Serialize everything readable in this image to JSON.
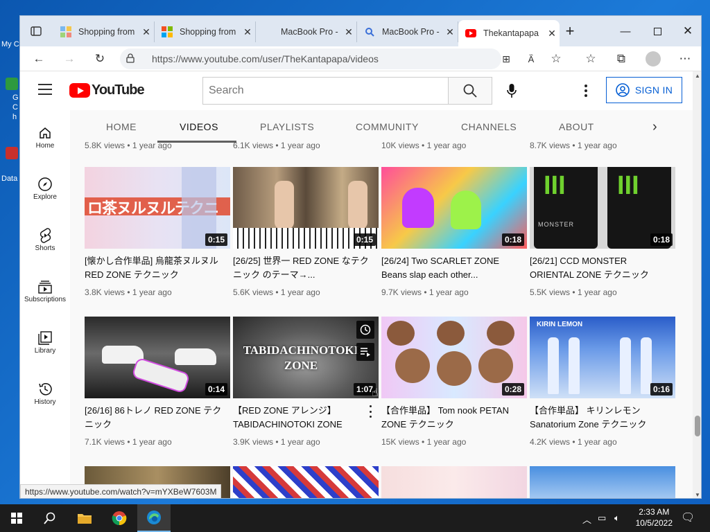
{
  "desktop": {
    "icons": [
      {
        "label": "My C"
      },
      {
        "label": "G Ch"
      },
      {
        "label": "Data"
      }
    ]
  },
  "browser": {
    "tabs": [
      {
        "title": "Shopping from",
        "icon": "shopping-favicon",
        "active": false
      },
      {
        "title": "Shopping from",
        "icon": "microsoft-favicon",
        "active": false
      },
      {
        "title": "MacBook Pro -",
        "icon": "apple-favicon",
        "active": false
      },
      {
        "title": "MacBook Pro -",
        "icon": "search-favicon",
        "active": false
      },
      {
        "title": "Thekantapapa",
        "icon": "youtube-favicon",
        "active": true
      }
    ],
    "url": "https://www.youtube.com/user/TheKantapapa/videos",
    "status_url": "https://www.youtube.com/watch?v=mYXBeW7603M"
  },
  "youtube": {
    "logo_text": "YouTube",
    "search_placeholder": "Search",
    "signin_label": "SIGN IN",
    "sidebar": [
      {
        "label": "Home",
        "icon": "home-icon"
      },
      {
        "label": "Explore",
        "icon": "compass-icon"
      },
      {
        "label": "Shorts",
        "icon": "shorts-icon"
      },
      {
        "label": "Subscriptions",
        "icon": "subscriptions-icon"
      },
      {
        "label": "Library",
        "icon": "library-icon"
      },
      {
        "label": "History",
        "icon": "history-icon"
      }
    ],
    "channel_tabs": [
      "HOME",
      "VIDEOS",
      "PLAYLISTS",
      "COMMUNITY",
      "CHANNELS",
      "ABOUT"
    ],
    "active_tab": "VIDEOS",
    "prev_row_meta": [
      {
        "views": "5.8K views",
        "age": "1 year ago"
      },
      {
        "views": "6.1K views",
        "age": "1 year ago"
      },
      {
        "views": "10K views",
        "age": "1 year ago"
      },
      {
        "views": "8.7K views",
        "age": "1 year ago"
      }
    ],
    "rows": [
      [
        {
          "title": "[懐かし合作単品] 烏龍茶ヌルヌル RED ZONE テクニック",
          "duration": "0:15",
          "views": "3.8K views",
          "age": "1 year ago",
          "thumb_text": "ロ茶ヌルヌルテクニ"
        },
        {
          "title": "[26/25] 世界一 RED ZONE なテクニック のテーマ→...",
          "duration": "0:15",
          "views": "5.6K views",
          "age": "1 year ago",
          "thumb_text": ""
        },
        {
          "title": "[26/24] Two SCARLET ZONE Beans slap each other...",
          "duration": "0:18",
          "views": "9.7K views",
          "age": "1 year ago",
          "thumb_text": ""
        },
        {
          "title": "[26/21] CCD MONSTER ORIENTAL ZONE テクニック",
          "duration": "0:18",
          "views": "5.5K views",
          "age": "1 year ago",
          "thumb_text": "MONSTER"
        }
      ],
      [
        {
          "title": "[26/16] 86トレノ RED ZONE テクニック",
          "duration": "0:14",
          "views": "7.1K views",
          "age": "1 year ago",
          "thumb_text": ""
        },
        {
          "title": "【RED ZONE アレンジ】TABIDACHINOTOKI ZONE",
          "duration": "1:07",
          "views": "3.9K views",
          "age": "1 year ago",
          "thumb_text": "TABIDACHINOTOKI ZONE"
        },
        {
          "title": "【合作単品】 Tom nook PETAN ZONE テクニック",
          "duration": "0:28",
          "views": "15K views",
          "age": "1 year ago",
          "thumb_text": ""
        },
        {
          "title": "【合作単品】 キリンレモン Sanatorium Zone テクニック",
          "duration": "0:16",
          "views": "4.2K views",
          "age": "1 year ago",
          "thumb_text": "KIRIN LEMON"
        }
      ]
    ]
  },
  "taskbar": {
    "time": "2:33 AM",
    "date": "10/5/2022"
  },
  "colors": {
    "youtube_red": "#ff0000",
    "signin_blue": "#065fd4",
    "taskbar": "#1c1c1c"
  }
}
